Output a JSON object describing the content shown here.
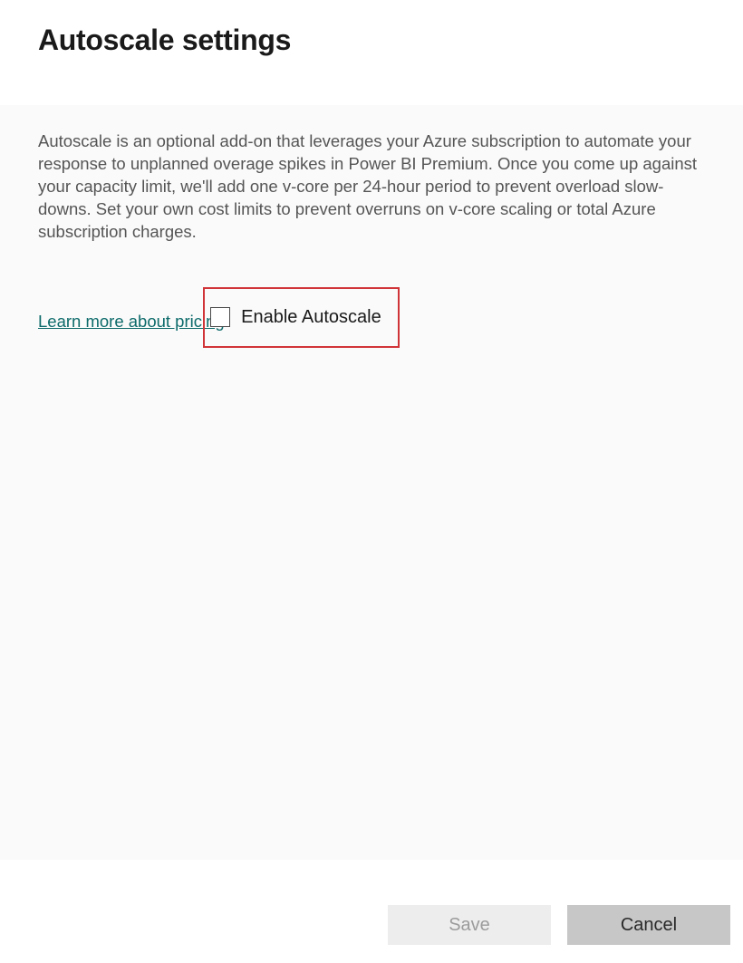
{
  "title": "Autoscale settings",
  "description": "Autoscale is an optional add-on that leverages your Azure subscription to automate your response to unplanned overage spikes in Power BI Premium. Once you come up against your capacity limit, we'll add one v-core per 24-hour period to prevent overload slow-downs. Set your own cost limits to prevent overruns on v-core scaling or total Azure subscription charges.",
  "pricing_link_label": "Learn more about pricing",
  "checkbox": {
    "label": "Enable Autoscale",
    "checked": false
  },
  "buttons": {
    "save": "Save",
    "cancel": "Cancel"
  }
}
